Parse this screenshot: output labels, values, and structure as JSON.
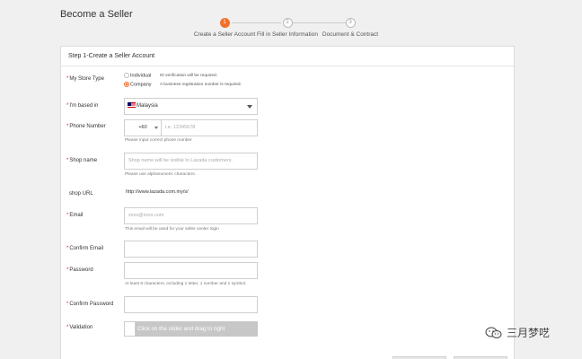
{
  "page": {
    "title": "Become a Seller"
  },
  "stepper": {
    "steps": [
      {
        "number": "1",
        "label": "Create a Seller Account"
      },
      {
        "number": "2",
        "label": "Fill in Seller Information"
      },
      {
        "number": "3",
        "label": "Document & Contract"
      }
    ],
    "active_step": 1,
    "accent_color": "#f36f2b"
  },
  "form": {
    "title": "Step 1-Create a Seller Account",
    "required_marker": "*",
    "store_type": {
      "label": "My Store Type",
      "options": [
        {
          "label": "Individual",
          "hint": "ID verification will be required.",
          "selected": false
        },
        {
          "label": "Company",
          "hint": "A business registration number is required.",
          "selected": true
        }
      ]
    },
    "based_in": {
      "label": "I'm based in",
      "value": "Malaysia",
      "flag": "malaysia-flag"
    },
    "phone": {
      "label": "Phone Number",
      "code": "+60",
      "placeholder": "i.e. 12345678",
      "hint": "Please input correct phone number"
    },
    "shop_name": {
      "label": "Shop name",
      "placeholder": "Shop name will be visible to Lazada customers.",
      "hint": "Please use alphanumeric characters."
    },
    "shop_url": {
      "label": "shop URL",
      "value": "http://www.lazada.com.my/s/"
    },
    "email": {
      "label": "Email",
      "placeholder": "xxxx@xxxx.com",
      "hint": "This email will be used for your seller center login"
    },
    "confirm_email": {
      "label": "Confirm Email"
    },
    "password": {
      "label": "Password",
      "hint": "At least 8 characters, including 1 letter, 1 number and 1 symbol."
    },
    "confirm_password": {
      "label": "Confirm Password"
    },
    "validation": {
      "label": "Validation",
      "slider_text": "Click on the slider and drag to right"
    }
  },
  "watermark": {
    "text": "三月梦呓",
    "icon": "wechat-icon"
  }
}
